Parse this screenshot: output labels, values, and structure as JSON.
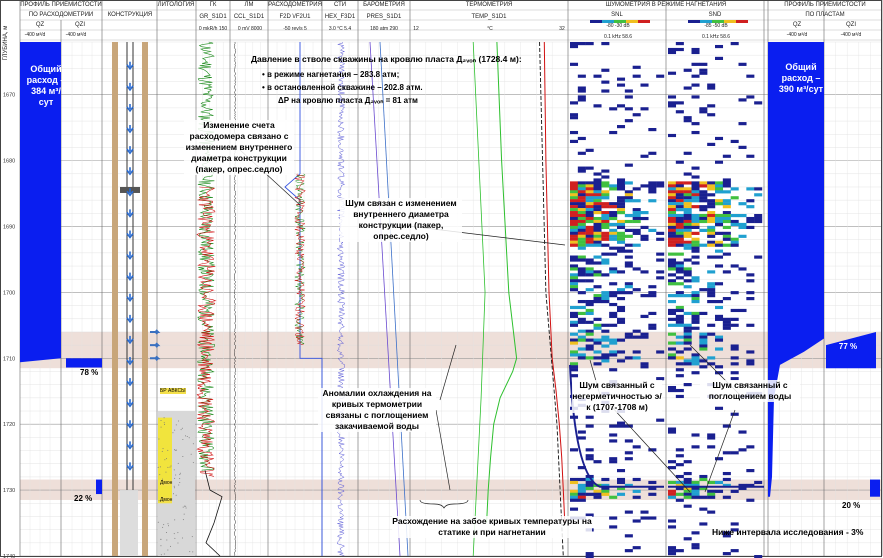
{
  "headers": {
    "depth_axis": "ГЛУБИНА, м",
    "profile_left": "ПРОФИЛЬ ПРИЕМИСТОСТИ",
    "flowmeter": "ПО РАСХОДОМЕТРИИ",
    "qz": "QZ",
    "qzi": "QZI",
    "qz_range": "-400  м³/d",
    "qzi_range": "-400  м³/d",
    "qz_range_right": "0",
    "qzi_range_right": "0",
    "construction": "КОНСТРУКЦИЯ",
    "lithology": "ЛИТОЛОГИЯ",
    "gk": "ГК",
    "gr": "GR_S1D1",
    "gr_range": "0   mkR/h 150",
    "lm": "ЛМ",
    "ccl": "CCL_S1D1",
    "ccl_range": "0   mV 8000",
    "rashodometry": "РАСХОДОМЕТРИЯ",
    "f2d": "F2D \\/F2U1",
    "f2d_range": "-50  rev/s   5",
    "sti": "СТИ",
    "hex": "HEX_F3D1",
    "hex_range": "3.0  °C  5.4",
    "barometry": "БАРОМЕТРИЯ",
    "pres": "PRES_S1D1",
    "pres_range": "180   atm   290",
    "thermometry": "ТЕРМОМЕТРИЯ",
    "temp": "TEMP_S1D1",
    "temp_range_min": "12",
    "temp_unit": "°C",
    "temp_range_max": "32",
    "noise": "ШУМОМЕТРИЯ В РЕЖИМЕ НАГНЕТАНИЯ",
    "snl": "SNL",
    "snd": "SND",
    "snl_scale": "-80          -30  dB",
    "snd_scale": "-85          -50  dB",
    "snl_x": "0.1     kHz      58.6",
    "snd_x": "0.1     kHz      58.6",
    "profile_right": "ПРОФИЛЬ ПРИЕМИСТОСТИ",
    "by_layers": "ПО ПЛАСТАМ"
  },
  "depth_ticks": [
    "1670",
    "1680",
    "1690",
    "1700",
    "1710",
    "1720",
    "1730",
    "1740"
  ],
  "annotations": {
    "pressure_title": "Давление в стволе скважины на кровлю пласта Д₂ᵥₒₙ (1728.4 м):",
    "pressure_inj": "в режиме нагнетания – 283.8 атм;",
    "pressure_stop": "в остановленной скважине – 202.8 атм.",
    "pressure_delta": "ΔP на кровлю пласта Д₂ᵥₒₙ = 81 атм",
    "flowmeter_change": "Изменение счета расходомера связано с изменением внутреннего диаметра конструкции (пакер, опрес.седло)",
    "noise_diameter": "Шум связан с изменением внутреннего диаметра конструкции (пакер, опрес.седло)",
    "cooling": "Аномалии охлаждения на кривых термометрии связаны с поглощением закачиваемой воды",
    "noise_leak": "Шум связанный с негерметичностью э/к (1707-1708 м)",
    "noise_absorb": "Шум связанный с поглощением воды",
    "temp_divergence": "Расхождение на забое кривых температуры на статике и при нагнетании",
    "below_interval": "Ниже интервала исследования - 3%",
    "total_left": "Общий расход – 384 м³/сут",
    "total_right": "Общий расход – 390 м³/сут",
    "pct_78": "78 %",
    "pct_22": "22 %",
    "pct_77": "77 %",
    "pct_20": "20 %",
    "litho_1": "БР АВКСЫ",
    "litho_2": "Дмон",
    "litho_3": "Дмон"
  },
  "colors": {
    "flow_blue": "#0a1ef0",
    "zone_pink": "#e8d4cc",
    "casing_tan": "#c8a67a",
    "gr_green": "#1a8a1a",
    "gr_red": "#d01010",
    "temp_green": "#2ec02e",
    "temp_red": "#d01010"
  },
  "chart_data": {
    "type": "line",
    "depth_range": [
      1662,
      1740
    ],
    "ylabel": "ГЛУБИНА, м",
    "highlight_zones": [
      [
        1706,
        1711.5
      ],
      [
        1728.4,
        1731.5
      ]
    ],
    "profile_flowmeter": {
      "depths": [
        1662,
        1710,
        1710.2,
        1711.2,
        1711.4,
        1728.4,
        1728.6,
        1730.5,
        1731
      ],
      "total_m3d": 384,
      "intervals_pct": [
        {
          "label": "78 %"
        },
        {
          "label": "22 %"
        }
      ]
    },
    "profile_layers": {
      "total_m3d": 390,
      "intervals_pct": [
        {
          "label": "77 %"
        },
        {
          "label": "20 %"
        },
        {
          "label": "Ниже интервала исследования - 3%"
        }
      ]
    },
    "pressure": {
      "injection_atm": 283.8,
      "static_atm": 202.8,
      "delta_atm": 81,
      "depth_m": 1728.4
    },
    "temperature_curves": [
      {
        "name": "TEMP_S1D1",
        "depths": [
          1662,
          1680,
          1700,
          1710,
          1715,
          1720,
          1725,
          1730,
          1735
        ],
        "values": [
          29,
          29.2,
          29.6,
          30,
          30.5,
          30.9,
          31.2,
          31.4,
          31.6
        ]
      },
      {
        "name": "TEMP_S1D1",
        "depths": [
          1662,
          1680,
          1700,
          1710,
          1712,
          1716,
          1720,
          1725,
          1730,
          1735
        ],
        "values": [
          23,
          23.6,
          24.5,
          25.5,
          25,
          23.4,
          22.6,
          22.2,
          21.9,
          21.7
        ]
      }
    ]
  }
}
